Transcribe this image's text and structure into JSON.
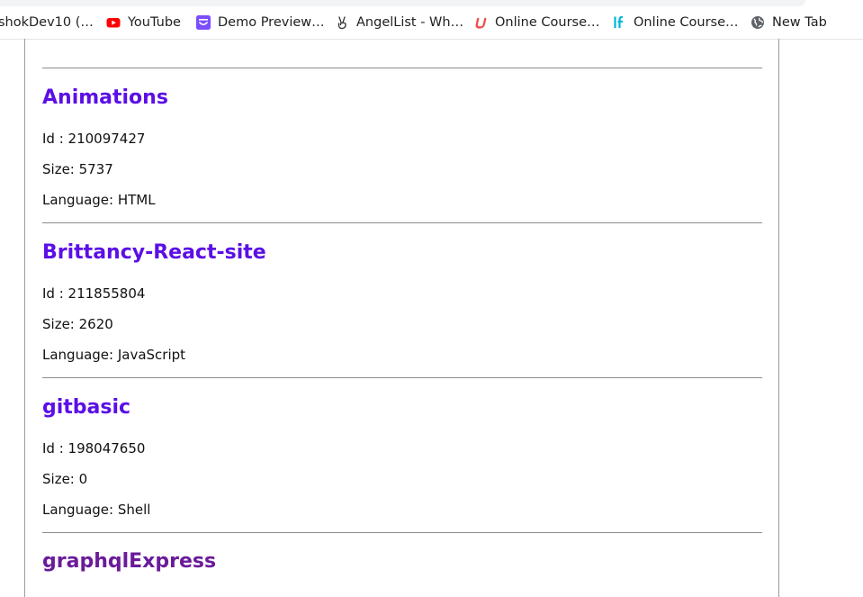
{
  "bookmarks": [
    {
      "label": "shokDev10 (…",
      "icon": "github-icon"
    },
    {
      "label": "YouTube",
      "icon": "youtube-icon"
    },
    {
      "label": "Demo Preview…",
      "icon": "preview-icon"
    },
    {
      "label": "AngelList - Wh…",
      "icon": "angellist-icon"
    },
    {
      "label": "Online Course…",
      "icon": "udemy-icon"
    },
    {
      "label": "Online Course…",
      "icon": "lf-icon"
    },
    {
      "label": "New Tab",
      "icon": "globe-icon"
    }
  ],
  "repos": [
    {
      "name": "Animations",
      "id_label": "Id : 210097427",
      "size_label": "Size: 5737",
      "language_label": "Language: HTML"
    },
    {
      "name": "Brittancy-React-site",
      "id_label": "Id : 211855804",
      "size_label": "Size: 2620",
      "language_label": "Language: JavaScript"
    },
    {
      "name": "gitbasic",
      "id_label": "Id : 198047650",
      "size_label": "Size: 0",
      "language_label": "Language: Shell"
    },
    {
      "name": "graphqlExpress"
    }
  ],
  "colors": {
    "link": "#5b0fe6",
    "visited_link": "#6a1b9a",
    "youtube_red": "#ff0000",
    "preview_purple": "#7c4dff",
    "udemy_red": "#ec5252",
    "lf_cyan": "#00b5d8"
  }
}
